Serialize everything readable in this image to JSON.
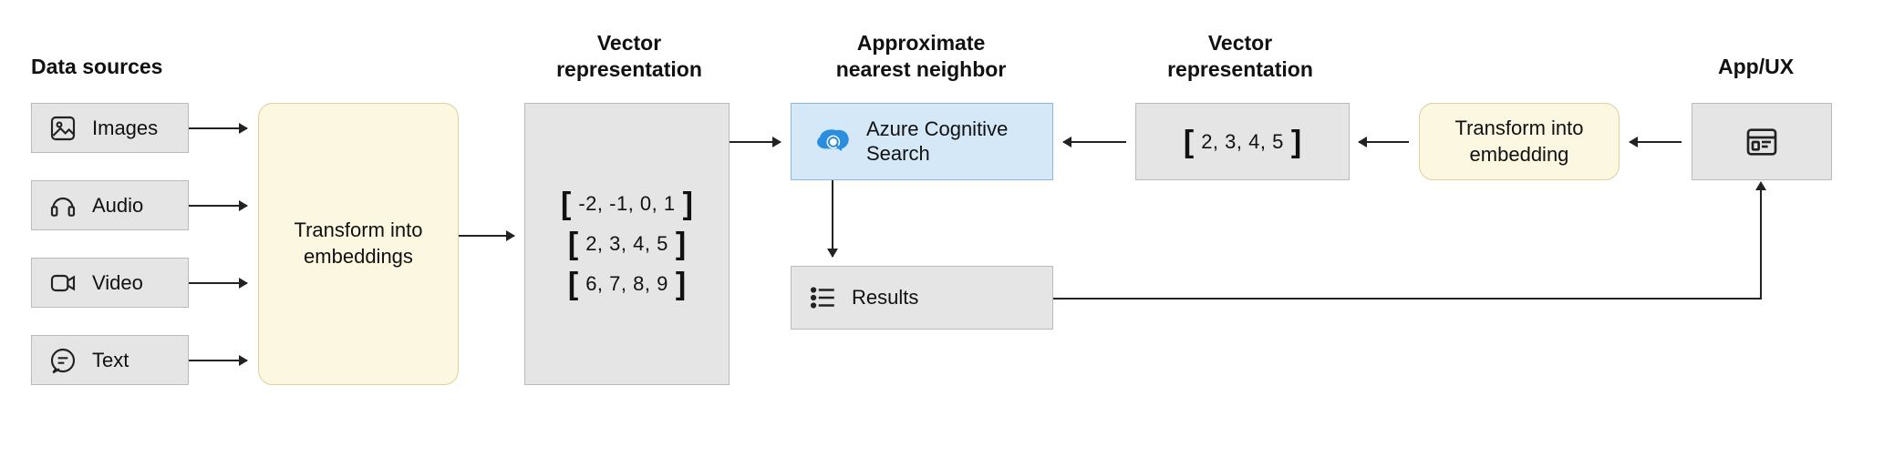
{
  "headings": {
    "data_sources": "Data sources",
    "vector_rep_left": "Vector\nrepresentation",
    "ann": "Approximate\nnearest neighbor",
    "vector_rep_right": "Vector\nrepresentation",
    "app_ux": "App/UX"
  },
  "sources": {
    "images": "Images",
    "audio": "Audio",
    "video": "Video",
    "text": "Text"
  },
  "transforms": {
    "left": "Transform into\nembeddings",
    "right": "Transform into\nembedding"
  },
  "vectors": {
    "v1": "-2, -1, 0, 1",
    "v2": "2, 3, 4, 5",
    "v3": "6, 7, 8, 9",
    "query": "2, 3, 4, 5"
  },
  "azure": {
    "label": "Azure Cognitive\nSearch"
  },
  "results": {
    "label": "Results"
  }
}
